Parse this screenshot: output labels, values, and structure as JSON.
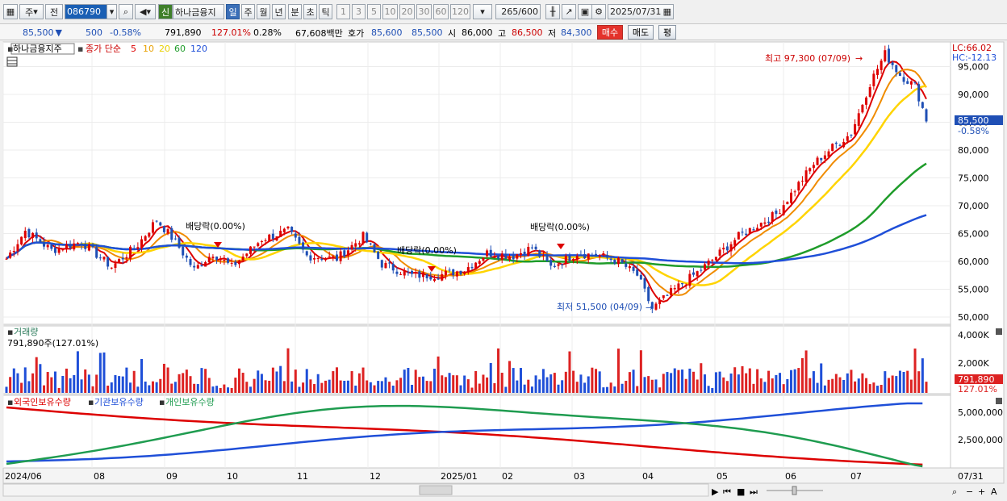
{
  "toolbar": {
    "menu1": "주",
    "menu2": "전",
    "stock_code": "086790",
    "badge": "신",
    "stock_name": "하나금융지",
    "periods": [
      "일",
      "주",
      "월",
      "년",
      "분",
      "초",
      "틱"
    ],
    "active_period": "일",
    "intervals": [
      "1",
      "3",
      "5",
      "10",
      "20",
      "30",
      "60",
      "120"
    ],
    "count": "265",
    "count_max": "/600",
    "date": "2025/07/31"
  },
  "info": {
    "price": "85,500",
    "change_arrow": "▼",
    "change": "500",
    "change_pct": "-0.58%",
    "volume": "791,890",
    "vol_ratio": "127.01%",
    "turnover_pct": "0.28%",
    "trade_value": "67,608백만",
    "quote_label": "호가",
    "ask": "85,600",
    "bid": "85,500",
    "open_label": "시",
    "open": "86,000",
    "high_label": "고",
    "high": "86,500",
    "low_label": "저",
    "low": "84,300",
    "buy_label": "매수",
    "sell_label": "매도",
    "eval_label": "평"
  },
  "price_panel": {
    "stock": "하나금융지주",
    "series_label": "종가 단순",
    "ma_periods": [
      "5",
      "10",
      "20",
      "60",
      "120"
    ],
    "ma_colors": [
      "#dd0000",
      "#f08c00",
      "#ffd400",
      "#1f9c2a",
      "#1f4fd8"
    ],
    "lc": "LC:66.02",
    "hc": "HC:-12.13",
    "axis_ticks": [
      95000,
      90000,
      85000,
      80000,
      75000,
      70000,
      65000,
      60000,
      55000,
      50000
    ],
    "axis_tick_labels": [
      "95,000",
      "90,000",
      "85,000",
      "80,000",
      "75,000",
      "70,000",
      "65,000",
      "60,000",
      "55,000",
      "50,000"
    ],
    "current_label": "85,500",
    "current_change": "-0.58%",
    "max_label": "최고 97,300 (07/09)",
    "min_label": "최저 51,500 (04/09)",
    "dividend_labels": [
      "배당락(0.00%)",
      "배당락(0.00%)",
      "배당락(0.00%)"
    ],
    "arrow_right": "→"
  },
  "volume_panel": {
    "title": "거래량",
    "value": "791,890주(127.01%)",
    "axis_ticks": [
      "4,000K",
      "2,000K"
    ],
    "current": "791,890",
    "current_pct": "127.01%"
  },
  "holdings_panel": {
    "legend": [
      "외국인보유수량",
      "기관보유수량",
      "개인보유수량"
    ],
    "legend_colors": [
      "#dd0000",
      "#1f4fd8",
      "#1f9c50"
    ],
    "axis_ticks": [
      "5,000,000",
      "2,500,000"
    ]
  },
  "xaxis": {
    "labels": [
      "2024/06",
      "08",
      "09",
      "10",
      "11",
      "12",
      "2025/01",
      "02",
      "03",
      "04",
      "05",
      "06",
      "07"
    ],
    "end_label": "07/31"
  },
  "chart_data": {
    "type": "line",
    "title": "하나금융지주",
    "ylim": [
      50000,
      97300
    ],
    "anchors": [
      {
        "t": 0,
        "close": 60500
      },
      {
        "t": 5,
        "close": 65500
      },
      {
        "t": 12,
        "close": 62000
      },
      {
        "t": 20,
        "close": 63500
      },
      {
        "t": 28,
        "close": 59000
      },
      {
        "t": 35,
        "close": 63000
      },
      {
        "t": 40,
        "close": 67500
      },
      {
        "t": 45,
        "close": 63500
      },
      {
        "t": 50,
        "close": 58500
      },
      {
        "t": 55,
        "close": 61500
      },
      {
        "t": 60,
        "close": 59000
      },
      {
        "t": 68,
        "close": 64000
      },
      {
        "t": 75,
        "close": 65500
      },
      {
        "t": 80,
        "close": 61000
      },
      {
        "t": 88,
        "close": 60500
      },
      {
        "t": 95,
        "close": 64500
      },
      {
        "t": 100,
        "close": 59500
      },
      {
        "t": 108,
        "close": 57500
      },
      {
        "t": 115,
        "close": 57500
      },
      {
        "t": 122,
        "close": 58500
      },
      {
        "t": 128,
        "close": 61500
      },
      {
        "t": 135,
        "close": 61000
      },
      {
        "t": 140,
        "close": 62500
      },
      {
        "t": 145,
        "close": 59000
      },
      {
        "t": 152,
        "close": 61500
      },
      {
        "t": 158,
        "close": 61000
      },
      {
        "t": 163,
        "close": 60000
      },
      {
        "t": 168,
        "close": 57500
      },
      {
        "t": 172,
        "close": 51500
      },
      {
        "t": 178,
        "close": 55000
      },
      {
        "t": 185,
        "close": 58500
      },
      {
        "t": 190,
        "close": 61500
      },
      {
        "t": 195,
        "close": 64500
      },
      {
        "t": 200,
        "close": 66500
      },
      {
        "t": 205,
        "close": 68500
      },
      {
        "t": 210,
        "close": 73000
      },
      {
        "t": 215,
        "close": 77500
      },
      {
        "t": 220,
        "close": 80500
      },
      {
        "t": 225,
        "close": 83000
      },
      {
        "t": 230,
        "close": 92000
      },
      {
        "t": 234,
        "close": 97300
      },
      {
        "t": 238,
        "close": 93500
      },
      {
        "t": 242,
        "close": 91500
      },
      {
        "t": 245,
        "close": 85500
      }
    ]
  }
}
